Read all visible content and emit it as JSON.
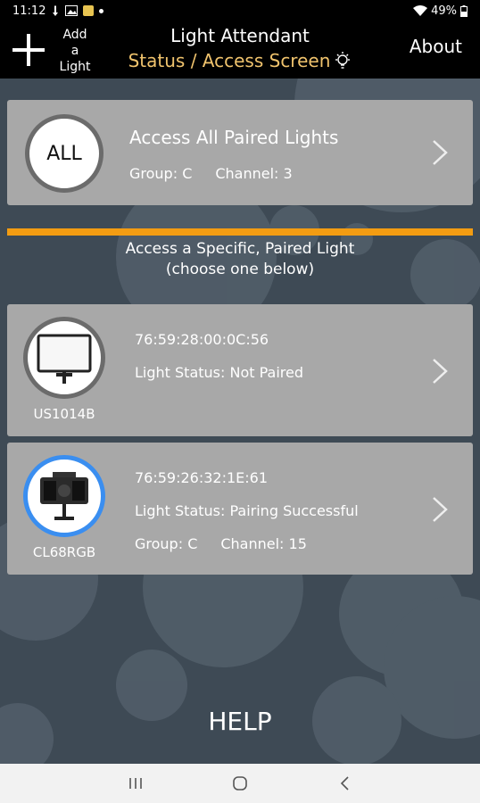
{
  "status_bar": {
    "time": "11:12",
    "battery": "49%"
  },
  "app_bar": {
    "add_label_line1": "Add",
    "add_label_line2": "a",
    "add_label_line3": "Light",
    "title": "Light Attendant",
    "subtitle": "Status / Access Screen",
    "about": "About"
  },
  "access_all": {
    "circle_label": "ALL",
    "title": "Access All Paired Lights",
    "group": "Group: C",
    "channel": "Channel: 3"
  },
  "section": {
    "line1": "Access a Specific, Paired Light",
    "line2": "(choose one below)"
  },
  "lights": [
    {
      "model": "US1014B",
      "mac": "76:59:28:00:0C:56",
      "status": "Light Status: Not Paired"
    },
    {
      "model": "CL68RGB",
      "mac": "76:59:26:32:1E:61",
      "status": "Light Status: Pairing Successful",
      "group": "Group: C",
      "channel": "Channel: 15"
    }
  ],
  "help": "HELP",
  "colors": {
    "background": "#3e4a55",
    "card": "#a8a8a8",
    "accent_orange": "#f39c12",
    "subtitle_gold": "#f0c36d",
    "paired_ring": "#3a8ef0"
  },
  "icons": {
    "add": "plus-icon",
    "bulb": "lightbulb-icon",
    "chevron": "chevron-right-icon",
    "nav_recent": "recents-icon",
    "nav_home": "home-icon",
    "nav_back": "back-icon"
  }
}
